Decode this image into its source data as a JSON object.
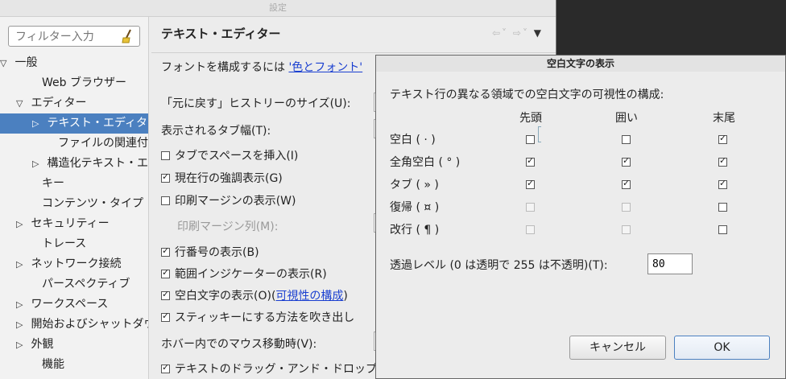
{
  "window": {
    "title": "設定"
  },
  "filter": {
    "placeholder": "フィルター入力"
  },
  "tree": [
    {
      "label": "一般",
      "toggle": "▽"
    },
    {
      "label": "Web ブラウザー",
      "toggle": ""
    },
    {
      "label": "エディター",
      "toggle": "▽"
    },
    {
      "label": "テキスト・エディター",
      "toggle": "▷"
    },
    {
      "label": "ファイルの関連付け",
      "toggle": ""
    },
    {
      "label": "構造化テキスト・エディター",
      "toggle": "▷"
    },
    {
      "label": "キー",
      "toggle": ""
    },
    {
      "label": "コンテンツ・タイプ",
      "toggle": ""
    },
    {
      "label": "セキュリティー",
      "toggle": "▷"
    },
    {
      "label": "トレース",
      "toggle": ""
    },
    {
      "label": "ネットワーク接続",
      "toggle": "▷"
    },
    {
      "label": "パースペクティブ",
      "toggle": ""
    },
    {
      "label": "ワークスペース",
      "toggle": "▷"
    },
    {
      "label": "開始およびシャットダウン",
      "toggle": "▷"
    },
    {
      "label": "外観",
      "toggle": "▷"
    },
    {
      "label": "機能",
      "toggle": ""
    }
  ],
  "page": {
    "title": "テキスト・エディター",
    "nav_icons": [
      "back-icon",
      "forward-icon",
      "menu-icon"
    ],
    "font_text": "フォントを構成するには",
    "font_link": "'色とフォント'",
    "undo_history": "「元に戻す」ヒストリーのサイズ(U):",
    "tab_width": "表示されるタブ幅(T):",
    "insert_spaces": "タブでスペースを挿入(I)",
    "highlight_line": "現在行の強調表示(G)",
    "show_margin": "印刷マージンの表示(W)",
    "margin_column": "印刷マージン列(M):",
    "line_numbers": "行番号の表示(B)",
    "range_indicator": "範囲インジケーターの表示(R)",
    "whitespace_text": "空白文字の表示(O)(",
    "whitespace_link": "可視性の構成",
    "whitespace_close": ")",
    "sticky": "スティッキーにする方法を吹き出し",
    "hover": "ホバー内でのマウス移動時(V):",
    "drag_drop": "テキストのドラッグ・アンド・ドロップ"
  },
  "checks": {
    "insert_spaces": false,
    "highlight_line": true,
    "show_margin": false,
    "line_numbers": true,
    "range_indicator": true,
    "whitespace": true,
    "sticky": true,
    "drag_drop": true
  },
  "dialog": {
    "title": "空白文字の表示",
    "description": "テキスト行の異なる領域での空白文字の可視性の構成:",
    "columns": [
      "先頭",
      "囲い",
      "末尾"
    ],
    "rows": [
      {
        "label": "空白 ( · )",
        "values": [
          false,
          false,
          true
        ],
        "disabled": [
          false,
          false,
          false
        ]
      },
      {
        "label": "全角空白 ( ° )",
        "values": [
          true,
          true,
          true
        ],
        "disabled": [
          false,
          false,
          false
        ]
      },
      {
        "label": "タブ ( » )",
        "values": [
          true,
          true,
          true
        ],
        "disabled": [
          false,
          false,
          false
        ]
      },
      {
        "label": "復帰 ( ¤ )",
        "values": [
          false,
          false,
          false
        ],
        "disabled": [
          true,
          true,
          false
        ]
      },
      {
        "label": "改行 ( ¶ )",
        "values": [
          false,
          false,
          false
        ],
        "disabled": [
          true,
          true,
          false
        ]
      }
    ],
    "alpha_label": "透過レベル (0 は透明で 255 は不透明)(T):",
    "alpha_value": "80",
    "cancel": "キャンセル",
    "ok": "OK"
  }
}
